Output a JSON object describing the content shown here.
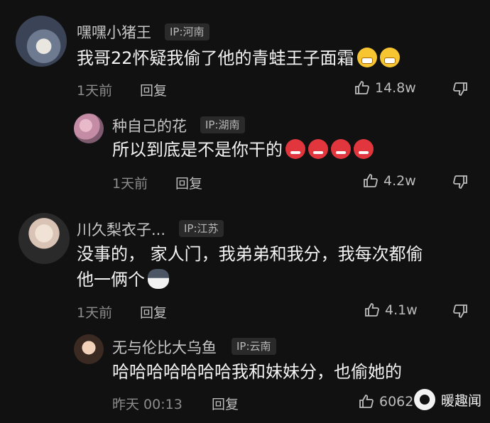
{
  "comments": [
    {
      "user": "嘿嘿小猪王",
      "ip": "IP:河南",
      "text": "我哥22怀疑我偷了他的青蛙王子面霜",
      "time": "1天前",
      "reply": "回复",
      "likes": "14.8w",
      "reactions": [
        "grinning-sweat-emoji",
        "grinning-sweat-emoji"
      ]
    },
    {
      "user": "种自己的花",
      "ip": "IP:湖南",
      "text": "所以到底是不是你干的",
      "time": "1天前",
      "reply": "回复",
      "likes": "4.2w",
      "reactions": [
        "angry-face-emoji",
        "angry-face-emoji",
        "angry-face-emoji",
        "angry-face-emoji"
      ]
    },
    {
      "user": "川久梨衣子...",
      "ip": "IP:江苏",
      "text_line1": "没事的， 家人门，我弟弟和我分，我每次都偷",
      "text_line2": "他一俩个",
      "time": "1天前",
      "reply": "回复",
      "likes": "4.1w",
      "reactions": [
        "husky-dog-emoji"
      ]
    },
    {
      "user": "无与伦比大乌鱼",
      "ip": "IP:云南",
      "text": "哈哈哈哈哈哈哈我和妹妹分，也偷她的",
      "time": "昨天 00:13",
      "reply": "回复",
      "likes": "6062"
    }
  ],
  "watermark": "暖趣闻",
  "icons": {
    "like": "thumbs-up-icon",
    "dislike": "thumbs-down-icon"
  }
}
